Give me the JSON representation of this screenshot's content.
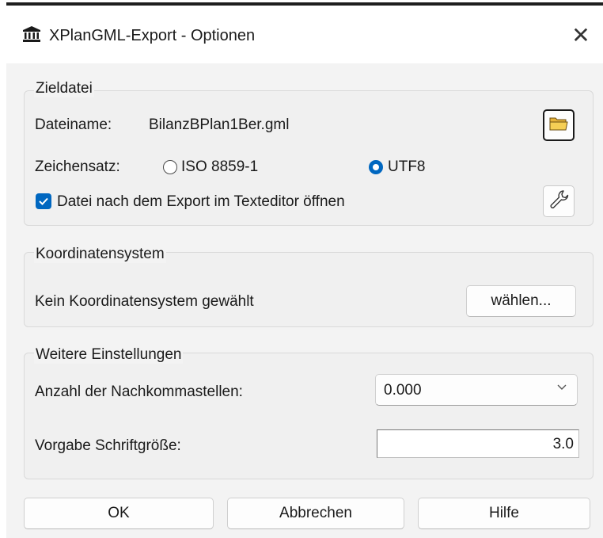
{
  "window": {
    "title": "XPlanGML-Export - Optionen",
    "close_glyph": "✕"
  },
  "zieldatei": {
    "group_label": "Zieldatei",
    "filename_label": "Dateiname:",
    "filename_value": "BilanzBPlan1Ber.gml",
    "charset_label": "Zeichensatz:",
    "charset_options": [
      {
        "label": "ISO 8859-1",
        "selected": false
      },
      {
        "label": "UTF8",
        "selected": true
      }
    ],
    "open_editor_label": "Datei nach dem Export im Texteditor öffnen",
    "open_editor_checked": true
  },
  "koordinaten": {
    "group_label": "Koordinatensystem",
    "status_text": "Kein Koordinatensystem gewählt",
    "choose_button": "wählen..."
  },
  "weitere": {
    "group_label": "Weitere Einstellungen",
    "decimals_label": "Anzahl der Nachkommastellen:",
    "decimals_value": "0.000",
    "fontsize_label": "Vorgabe Schriftgröße:",
    "fontsize_value": "3.0"
  },
  "buttons": {
    "ok": "OK",
    "cancel": "Abbrechen",
    "help": "Hilfe"
  },
  "colors": {
    "accent": "#0067c0",
    "dialog_bg": "#f3f3f3"
  }
}
